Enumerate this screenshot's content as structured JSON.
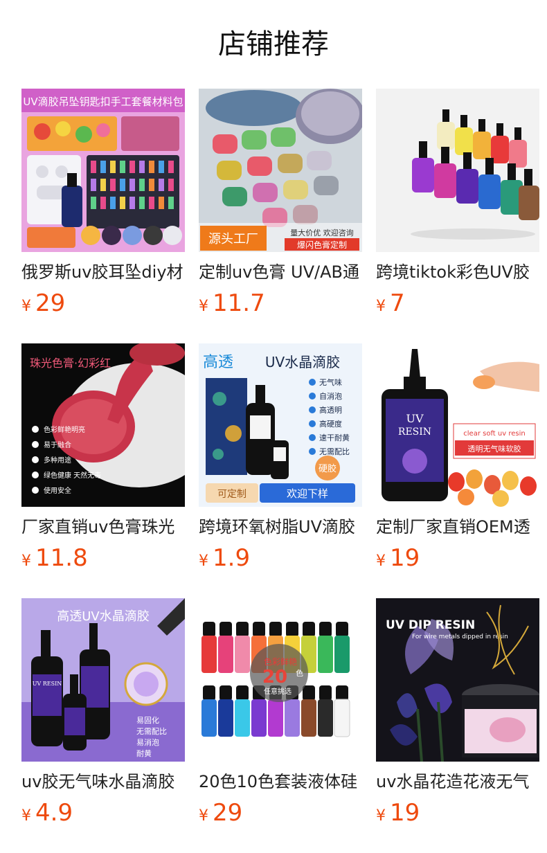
{
  "section_title": "店铺推荐",
  "currency": "¥",
  "products": [
    {
      "name": "俄罗斯uv胶耳坠diy材",
      "price": "29",
      "img_text": [
        "UV滴胶吊坠钥匙扣手工套餐材料包"
      ]
    },
    {
      "name": "定制uv色膏 UV/AB通",
      "price": "11.7",
      "img_text": [
        "源头工厂",
        "量大价优 欢迎咨询",
        "爆闪色膏定制"
      ]
    },
    {
      "name": "跨境tiktok彩色UV胶",
      "price": "7",
      "img_text": []
    },
    {
      "name": "厂家直销uv色膏珠光",
      "price": "11.8",
      "img_text": [
        "珠光色膏·幻彩红",
        "色彩鲜艳明亮",
        "易于融合",
        "多种用途",
        "绿色健康 天然无毒",
        "使用安全"
      ]
    },
    {
      "name": "跨境环氧树脂UV滴胶",
      "price": "1.9",
      "img_text": [
        "高透",
        "UV水晶滴胶",
        "无气味",
        "自消泡",
        "高透明",
        "高硬度",
        "速干耐黄",
        "无需配比",
        "硬胶",
        "可定制",
        "欢迎下样"
      ]
    },
    {
      "name": "定制厂家直销OEM透",
      "price": "19",
      "img_text": [
        "clear soft uv resin",
        "透明无气味软胶",
        "UV",
        "RESIN"
      ]
    },
    {
      "name": "uv胶无气味水晶滴胶",
      "price": "4.9",
      "img_text": [
        "高透UV水晶滴胶",
        "UV RESIN",
        "易固化",
        "无需配比",
        "易消泡",
        "耐黄"
      ]
    },
    {
      "name": "20色10色套装液体硅",
      "price": "29",
      "img_text": [
        "色彩鲜艳",
        "20",
        "色",
        "任意挑选"
      ]
    },
    {
      "name": "uv水晶花造花液无气",
      "price": "19",
      "img_text": [
        "UV DIP RESIN",
        "For wire metals dipped in resin"
      ]
    }
  ]
}
